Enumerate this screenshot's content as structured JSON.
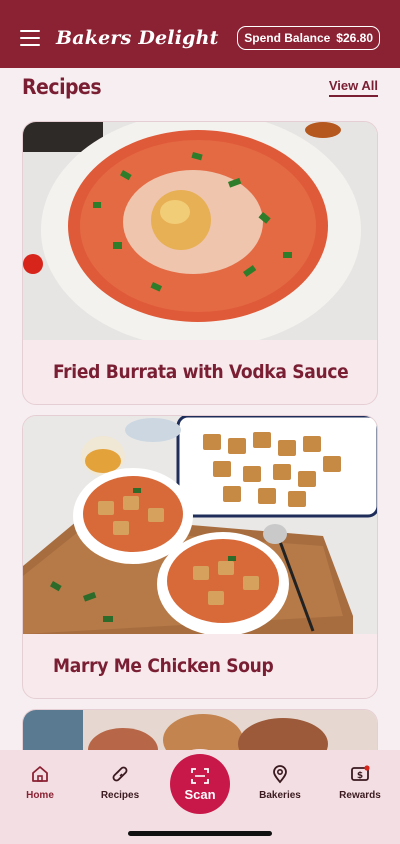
{
  "header": {
    "brand": "Bakers Delight",
    "spend_label": "Spend Balance",
    "spend_value": "$26.80"
  },
  "section": {
    "title": "Recipes",
    "view_all": "View All"
  },
  "recipes": [
    {
      "title": "Fried Burrata with Vodka Sauce"
    },
    {
      "title": "Marry Me Chicken Soup"
    }
  ],
  "nav": {
    "home": "Home",
    "recipes": "Recipes",
    "scan": "Scan",
    "bakeries": "Bakeries",
    "rewards": "Rewards"
  },
  "colors": {
    "brand": "#8b2234",
    "scan": "#c8184a",
    "background": "#f6eef0"
  }
}
